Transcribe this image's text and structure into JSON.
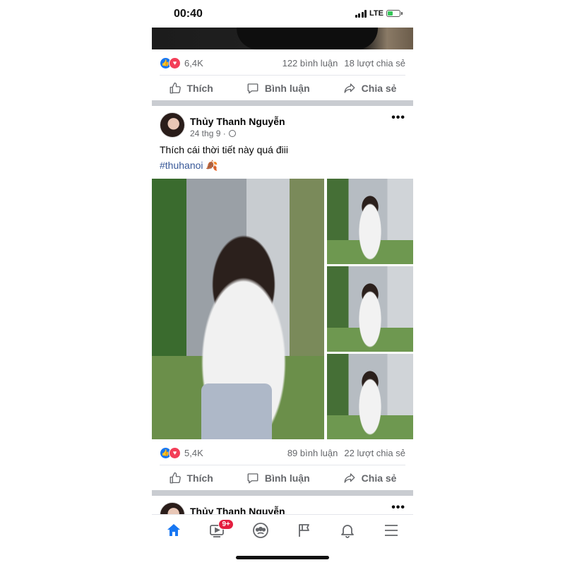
{
  "status_bar": {
    "time": "00:40",
    "network": "LTE"
  },
  "previous_post": {
    "reaction_count": "6,4K",
    "comments": "122 bình luận",
    "shares": "18 lượt chia sẻ"
  },
  "actions": {
    "like": "Thích",
    "comment": "Bình luận",
    "share": "Chia sẻ"
  },
  "post": {
    "author": "Thủy Thanh Nguyễn",
    "date": "24 thg 9 ·",
    "text": "Thích cái thời tiết này quá điii",
    "hashtag": "#thuhanoi 🍂",
    "reaction_count": "5,4K",
    "comments": "89 bình luận",
    "shares": "22 lượt chia sẻ"
  },
  "next_post": {
    "author": "Thủy Thanh Nguyễn"
  },
  "tab_bar": {
    "video_badge": "9+",
    "active_tab": "home",
    "accent": "#1877f2"
  },
  "icons": [
    "like-icon",
    "love-icon",
    "comment-icon",
    "share-icon",
    "globe-icon",
    "more-icon",
    "home-icon",
    "video-icon",
    "groups-icon",
    "flag-icon",
    "bell-icon",
    "menu-icon"
  ]
}
